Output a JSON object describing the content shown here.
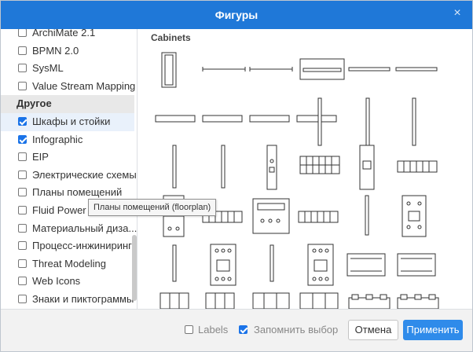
{
  "dialog": {
    "title": "Фигуры",
    "close_glyph": "×",
    "colors": {
      "titlebar": "#1f78d8",
      "apply": "#2f8bea",
      "accent": "#1a73e8"
    }
  },
  "sidebar": {
    "items": [
      {
        "type": "item",
        "label": "ArchiMate 2.1",
        "checked": false
      },
      {
        "type": "item",
        "label": "BPMN 2.0",
        "checked": false
      },
      {
        "type": "item",
        "label": "SysML",
        "checked": false
      },
      {
        "type": "item",
        "label": "Value Stream Mapping",
        "checked": false
      },
      {
        "type": "group",
        "label": "Другое"
      },
      {
        "type": "item",
        "label": "Шкафы и стойки",
        "checked": true,
        "selected": true
      },
      {
        "type": "item",
        "label": "Infographic",
        "checked": true
      },
      {
        "type": "item",
        "label": "EIP",
        "checked": false
      },
      {
        "type": "item",
        "label": "Электрические схемы",
        "checked": false
      },
      {
        "type": "item",
        "label": "Планы помещений",
        "checked": false
      },
      {
        "type": "item",
        "label": "Fluid Power (I",
        "checked": false
      },
      {
        "type": "item",
        "label": "Материальный диза...",
        "checked": false
      },
      {
        "type": "item",
        "label": "Процесс-инжиниринг",
        "checked": false
      },
      {
        "type": "item",
        "label": "Threat Modeling",
        "checked": false
      },
      {
        "type": "item",
        "label": "Web Icons",
        "checked": false
      },
      {
        "type": "item",
        "label": "Знаки и пиктограммы",
        "checked": false
      }
    ]
  },
  "tooltip": {
    "text": "Планы помещений (floorplan)"
  },
  "content": {
    "section_title": "Cabinets"
  },
  "footer": {
    "labels_text": "Labels",
    "labels_checked": false,
    "remember_text": "Запомнить выбор",
    "remember_checked": true,
    "cancel_label": "Отмена",
    "apply_label": "Применить"
  }
}
